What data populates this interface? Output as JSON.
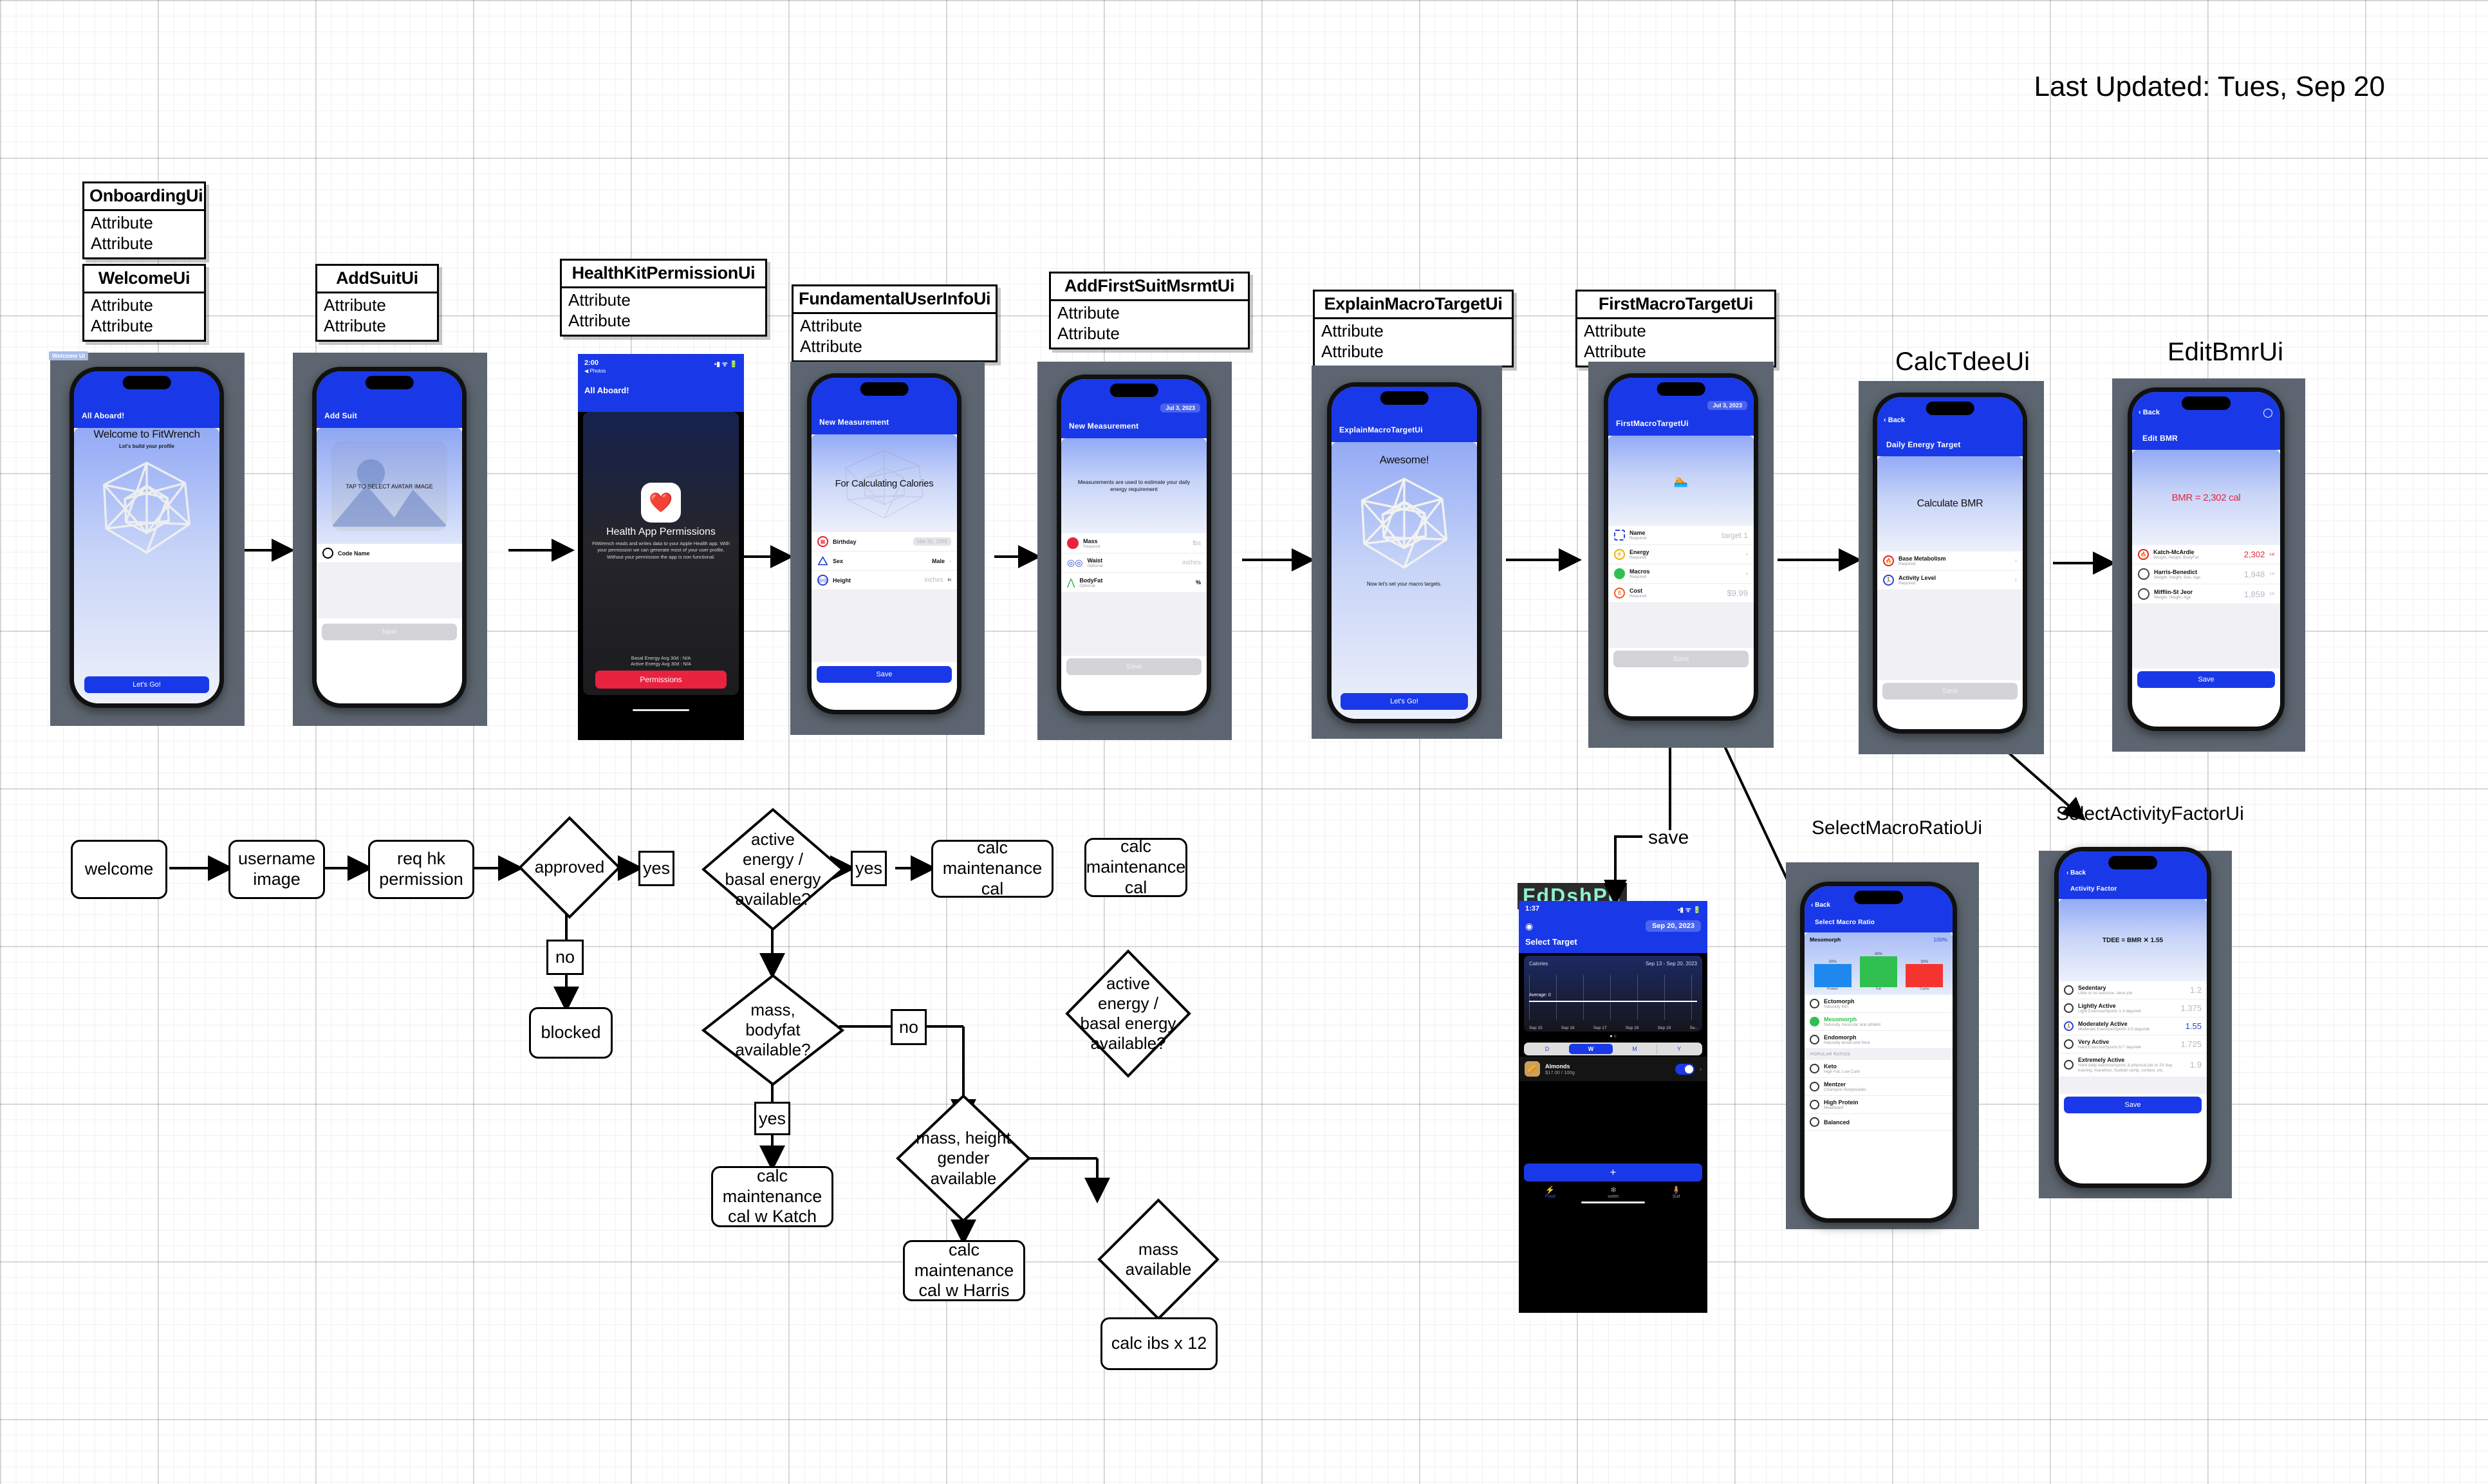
{
  "header": {
    "last_updated": "Last Updated: Tues, Sep 20"
  },
  "uml_classes": [
    {
      "name": "OnboardingUi",
      "attrs": [
        "Attribute",
        "Attribute"
      ]
    },
    {
      "name": "WelcomeUi",
      "attrs": [
        "Attribute",
        "Attribute"
      ]
    },
    {
      "name": "AddSuitUi",
      "attrs": [
        "Attribute",
        "Attribute"
      ]
    },
    {
      "name": "HealthKitPermissionUi",
      "attrs": [
        "Attribute",
        "Attribute"
      ]
    },
    {
      "name": "FundamentalUserInfoUi",
      "attrs": [
        "Attribute",
        "Attribute"
      ]
    },
    {
      "name": "AddFirstSuitMsrmtUi",
      "attrs": [
        "Attribute",
        "Attribute"
      ]
    },
    {
      "name": "ExplainMacroTargetUi",
      "attrs": [
        "Attribute",
        "Attribute"
      ]
    },
    {
      "name": "FirstMacroTargetUi",
      "attrs": [
        "Attribute",
        "Attribute"
      ]
    }
  ],
  "screen_labels": {
    "calc_tdee": "CalcTdeeUi",
    "edit_bmr": "EditBmrUi",
    "select_macro_ratio": "SelectMacroRatioUi",
    "select_activity_factor": "SelectActivityFactorUi",
    "fd_dsh_pg": "FdDshPg",
    "save_edge": "save"
  },
  "phones": {
    "welcome": {
      "tag": "Welcome Ui",
      "nav_title": "All Aboard!",
      "heading": "Welcome to FitWrench",
      "subheading": "Let's build your profile",
      "cta": "Let's Go!"
    },
    "add_suit": {
      "nav_title": "Add Suit",
      "placeholder_text": "TAP TO SELECT AVATAR IMAGE",
      "field_label": "Code Name",
      "cta": "Next"
    },
    "healthkit": {
      "status_time": "2:00",
      "status_back": "Photos",
      "nav_title": "All Aboard!",
      "heading": "Health App Permissions",
      "body": "FitWrench reads and writes data to your Apple Health app. With your permission we can generate most of your user profile. Without your permission the app is non functional.",
      "stat_basal": "Basal Energy Avg 30d : N/A",
      "stat_active": "Active Energy Avg 30d : N/A",
      "cta": "Permissions"
    },
    "fundamental": {
      "nav_title": "New Measurement",
      "heading": "For Calculating Calories",
      "rows": [
        {
          "icon": "calendar-icon",
          "label": "Birthday",
          "value": "Mar 31, 1999"
        },
        {
          "icon": "triangle-icon",
          "label": "Sex",
          "value": "Male"
        },
        {
          "icon": "tape-icon",
          "label": "Height",
          "value": "inches",
          "unit": "in"
        }
      ],
      "cta": "Save"
    },
    "first_suit_msrmt": {
      "nav_title": "New Measurement",
      "date_chip": "Jul 3, 2023",
      "hero_text": "Measurements are used to estimate your daily energy requirement",
      "rows": [
        {
          "icon": "globe-icon",
          "label": "Mass",
          "sub": "Required",
          "value": "lbs"
        },
        {
          "icon": "tape-icon",
          "label": "Waist",
          "sub": "Optional",
          "value": "inches"
        },
        {
          "icon": "caliper-icon",
          "label": "BodyFat",
          "sub": "Optional",
          "value": "%"
        }
      ],
      "cta": "Save"
    },
    "explain_macro": {
      "nav_title": "ExplainMacroTargetUi",
      "heading": "Awesome!",
      "caption": "Now let's set your macro targets.",
      "cta": "Let's Go!"
    },
    "first_macro": {
      "nav_title": "FirstMacroTargetUi",
      "date_chip": "Jul 3, 2023",
      "rows": [
        {
          "icon": "scan-icon",
          "label": "Name",
          "sub": "Required",
          "value": "target 1"
        },
        {
          "icon": "bolt-icon",
          "label": "Energy",
          "sub": "Required",
          "value": "›"
        },
        {
          "icon": "pie-icon",
          "label": "Macros",
          "sub": "Required",
          "value": "›"
        },
        {
          "icon": "cost-icon",
          "label": "Cost",
          "sub": "Required",
          "value": "$9.99"
        }
      ],
      "cta": "Save"
    },
    "calc_tdee": {
      "back": "Back",
      "nav_title": "Daily Energy Target",
      "heading": "Calculate BMR",
      "rows": [
        {
          "icon": "flame-icon",
          "label": "Base Metabolism",
          "sub": "Required",
          "value": "›"
        },
        {
          "icon": "runner-icon",
          "label": "Activity Level",
          "sub": "Required",
          "value": "›"
        }
      ],
      "cta": "Save"
    },
    "edit_bmr": {
      "back": "Back",
      "nav_title": "Edit BMR",
      "heading": "BMR = 2,302 cal",
      "rows": [
        {
          "icon": "flame-icon",
          "label": "Katch-McArdle",
          "sub": "Weight, Height, BodyFat",
          "value": "2,302",
          "unit": "cal",
          "selected": true
        },
        {
          "icon": "radio-icon",
          "label": "Harris-Benedict",
          "sub": "Weight, Height, Sex, Age",
          "value": "1,948",
          "unit": "cal",
          "selected": false
        },
        {
          "icon": "radio-icon",
          "label": "Mifflin-St Jeor",
          "sub": "Weight, Height, Age",
          "value": "1,859",
          "unit": "cal",
          "selected": false
        }
      ],
      "cta": "Save"
    },
    "select_macro_ratio": {
      "back": "Back",
      "nav_title": "Select Macro Ratio",
      "chart_label": "Mesomorph",
      "chart_total": "100%",
      "options": [
        {
          "label": "Ectomorph",
          "sub": "Naturally thin",
          "selected": false
        },
        {
          "label": "Mesomorph",
          "sub": "Naturally muscular and athletic",
          "selected": true
        },
        {
          "label": "Endomorph",
          "sub": "Naturally broad and thick",
          "selected": false
        }
      ],
      "section_header": "POPULAR RATIOS",
      "popular": [
        {
          "label": "Keto",
          "sub": "High Fat, Low Carb",
          "selected": false
        },
        {
          "label": "Mentzer",
          "sub": "Champion Bodybuilder",
          "selected": false
        },
        {
          "label": "High Protein",
          "sub": "Meathead!",
          "selected": false
        },
        {
          "label": "Balanced",
          "sub": "",
          "selected": false
        }
      ]
    },
    "select_activity_factor": {
      "back": "Back",
      "nav_title": "Activity Factor",
      "formula": "TDEE = BMR ✕ 1.55",
      "options": [
        {
          "label": "Sedentary",
          "sub": "Little or no exercise, desk job",
          "value": "1.2",
          "selected": false
        },
        {
          "label": "Lightly Active",
          "sub": "Light Exercise/Sports 1-3 days/wk",
          "value": "1.375",
          "selected": false
        },
        {
          "label": "Moderately Active",
          "sub": "Moderate Exercise/Sports 3-5 days/wk",
          "value": "1.55",
          "selected": true
        },
        {
          "label": "Very Active",
          "sub": "Hard Exercise/Sports 6-7 days/wk",
          "value": "1.725",
          "selected": false
        },
        {
          "label": "Extremely Active",
          "sub": "Hard daily exercise/sports & physical job or 2X day training, marathon, football camp, contest, etc.",
          "value": "1.9",
          "selected": false
        }
      ],
      "cta": "Save"
    },
    "fd_dsh_pg": {
      "status_time": "1:37",
      "date_chip": "Sep 20, 2023",
      "nav_title": "Select Target",
      "chart_title": "Calories",
      "chart_range": "Sep 13 - Sep 20, 2023",
      "chart_average": "Average: 0",
      "segments": [
        "D",
        "W",
        "M",
        "Y"
      ],
      "segment_selected": "W",
      "food_item": {
        "name": "Almonds",
        "price": "$17.00 / 100g",
        "toggle_on": true
      },
      "tabs": [
        {
          "label": "Food",
          "icon": "bolt-icon",
          "active": true
        },
        {
          "label": "water",
          "icon": "snowflake-icon",
          "active": false
        },
        {
          "label": "Suit",
          "icon": "person-icon",
          "active": false
        }
      ],
      "add_button": "+"
    }
  },
  "flowchart": {
    "nodes": [
      {
        "id": "welcome",
        "label": "welcome"
      },
      {
        "id": "username-image",
        "label": "username\nimage"
      },
      {
        "id": "req-hk-permission",
        "label": "req hk\npermission"
      },
      {
        "id": "approved",
        "label": "approved"
      },
      {
        "id": "blocked",
        "label": "blocked"
      },
      {
        "id": "active-basal-1",
        "label": "active\nenergy /\nbasal energy\navailable?"
      },
      {
        "id": "calc-maintenance-cal",
        "label": "calc maintenance\ncal"
      },
      {
        "id": "calc-maintenance-cal-2",
        "label": "calc\nmaintenance\ncal"
      },
      {
        "id": "active-basal-2",
        "label": "active\nenergy /\nbasal energy\navailable?"
      },
      {
        "id": "mass-bodyfat",
        "label": "mass,\nbodyfat\navailable?"
      },
      {
        "id": "calc-katch",
        "label": "calc maintenance\ncal w Katch"
      },
      {
        "id": "mass-height-gender",
        "label": "mass, height\ngender\navailable"
      },
      {
        "id": "calc-harris",
        "label": "calc maintenance\ncal w Harris"
      },
      {
        "id": "mass-available",
        "label": "mass\navailable"
      },
      {
        "id": "calc-lbs",
        "label": "calc ibs x 12"
      }
    ],
    "edge_labels": [
      "yes",
      "no",
      "yes",
      "yes",
      "no"
    ]
  },
  "chart_data": [
    {
      "type": "bar",
      "title": "Mesomorph",
      "categories": [
        "Protein",
        "Fat",
        "Carbs"
      ],
      "values": [
        30,
        40,
        30
      ],
      "data_labels": [
        "30%",
        "40%",
        "30%"
      ],
      "colors": [
        "#1e88ee",
        "#2fc04f",
        "#f6342f"
      ],
      "ylim": [
        0,
        50
      ],
      "xlabel": "",
      "ylabel": "",
      "grid": true,
      "annotation": "100%"
    },
    {
      "type": "line",
      "title": "Calories",
      "subtitle": "Sep 13 - Sep 20, 2023",
      "categories": [
        "Sep 15",
        "Sep 16",
        "Sep 17",
        "Sep 18",
        "Sep 19",
        "Se..."
      ],
      "values": [
        0,
        0,
        0,
        0,
        0,
        0
      ],
      "annotation": "Average: 0",
      "ylim": [
        0,
        1
      ],
      "grid": true
    }
  ],
  "colors": {
    "brand_blue": "#1939e8",
    "accent_red": "#e8233f",
    "green": "#2fc04f",
    "chart_blue": "#1e88ee",
    "chart_red": "#f6342f",
    "tag_mint": "#8ff0d2"
  }
}
